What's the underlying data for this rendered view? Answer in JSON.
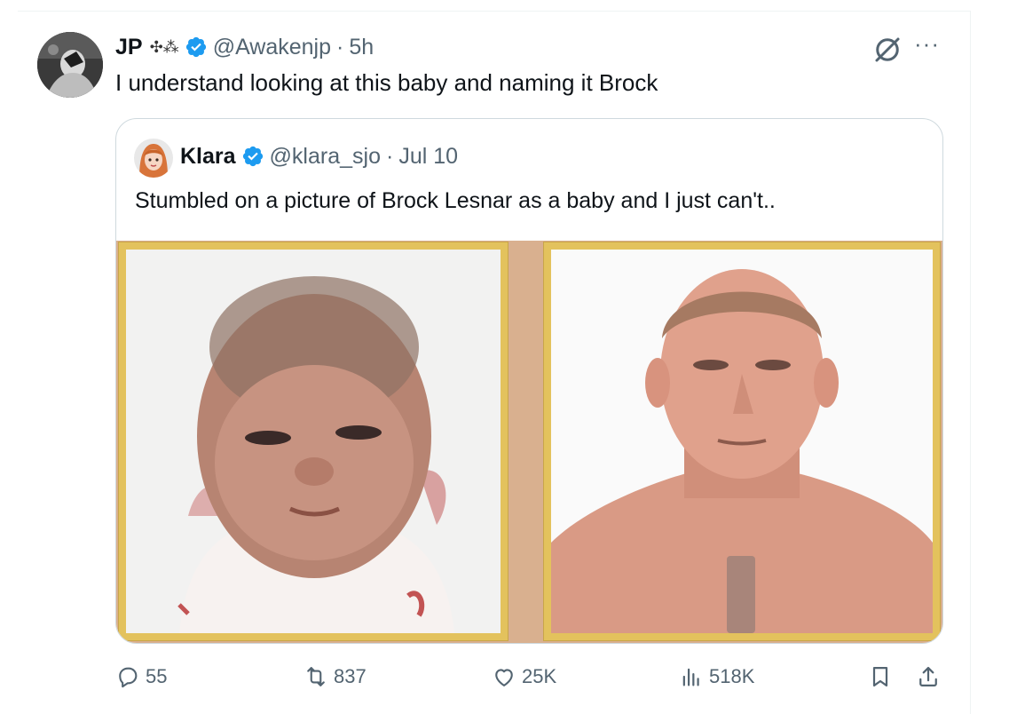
{
  "post": {
    "author_name": "JP",
    "author_emoji": "✣⁂",
    "handle": "@Awakenjp",
    "separator": "·",
    "time": "5h",
    "text": "I understand looking at this baby and naming it Brock"
  },
  "quote": {
    "author_name": "Klara",
    "handle": "@klara_sjo",
    "separator": "·",
    "date": "Jul 10",
    "text": "Stumbled on a picture of Brock Lesnar as a baby and I just can't.."
  },
  "actions": {
    "replies": "55",
    "reposts": "837",
    "likes": "25K",
    "views": "518K"
  },
  "colors": {
    "verified": "#1d9bf0",
    "muted_text": "#536471",
    "frame_gold": "#e3c25d"
  },
  "icons": [
    "verified-badge-icon",
    "grok-icon",
    "more-icon",
    "reply-icon",
    "repost-icon",
    "like-icon",
    "views-icon",
    "bookmark-icon",
    "share-icon"
  ]
}
